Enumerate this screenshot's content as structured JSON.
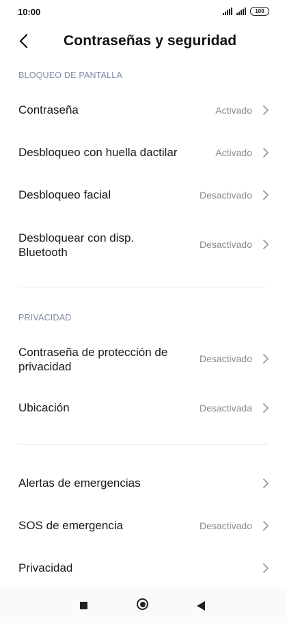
{
  "status_bar": {
    "time": "10:00",
    "battery": "100"
  },
  "header": {
    "title": "Contraseñas y seguridad"
  },
  "sections": {
    "screen_lock": "BLOQUEO DE PANTALLA",
    "privacy": "PRIVACIDAD"
  },
  "rows": [
    {
      "label": "Contraseña",
      "value": "Activado"
    },
    {
      "label": "Desbloqueo con huella dactilar",
      "value": "Activado"
    },
    {
      "label": "Desbloqueo facial",
      "value": "Desactivado"
    },
    {
      "label": "Desbloquear con disp.\nBluetooth",
      "value": "Desactivado"
    },
    {
      "label": "Contraseña de protección de\nprivacidad",
      "value": "Desactivado"
    },
    {
      "label": "Ubicación",
      "value": "Desactivada"
    },
    {
      "label": "Alertas de emergencias",
      "value": ""
    },
    {
      "label": "SOS de emergencia",
      "value": "Desactivado"
    },
    {
      "label": "Privacidad",
      "value": ""
    }
  ],
  "icons": {
    "back": "back-arrow-icon",
    "chevron": "chevron-right-icon",
    "nav_recents": "square-icon",
    "nav_home": "circle-icon",
    "nav_back": "triangle-back-icon"
  },
  "colors": {
    "section_label": "#7b8aa6",
    "value_text": "#8a8a8a",
    "chevron": "#9a9a9a"
  }
}
